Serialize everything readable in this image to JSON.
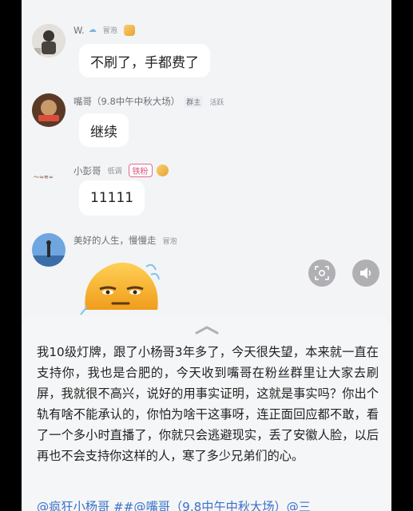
{
  "messages": [
    {
      "name": "W.",
      "tags": [
        "冒泡"
      ],
      "text": "不刷了，手都费了"
    },
    {
      "name": "嘴哥（9.8中午中秋大场）",
      "tags": [
        "群主",
        "活跃"
      ],
      "text": "继续"
    },
    {
      "name": "小彭哥",
      "tags": [
        "低调",
        "铁粉"
      ],
      "text": "11111"
    },
    {
      "name": "美好的人生，慢慢走",
      "tags": [
        "冒泡"
      ],
      "text": ""
    }
  ],
  "icons": {
    "zoom": "lens-scan-icon",
    "volume": "volume-icon",
    "sticker": "sleepy-face-sticker",
    "handle": "chevron-up-icon"
  },
  "comment": {
    "body": "我10级灯牌，跟了小杨哥3年多了，今天很失望，本来就一直在支持你，我也是合肥的，今天收到嘴哥在粉丝群里让大家去刷屏，我就很不高兴，说好的用事实证明，这就是事实吗？你出个轨有啥不能承认的，你怕为啥干这事呀，连正面回应都不敢，看了一个多小时直播了，你就只会逃避现实，丢了安徽人脸，以后再也不会支持你这样的人，寒了多少兄弟们的心。",
    "mentions": "@疯狂小杨哥 ##@嘴哥（9.8中午中秋大场）@三"
  },
  "colors": {
    "accent_link": "#3a72c9",
    "fan_badge": "#d9567e"
  }
}
